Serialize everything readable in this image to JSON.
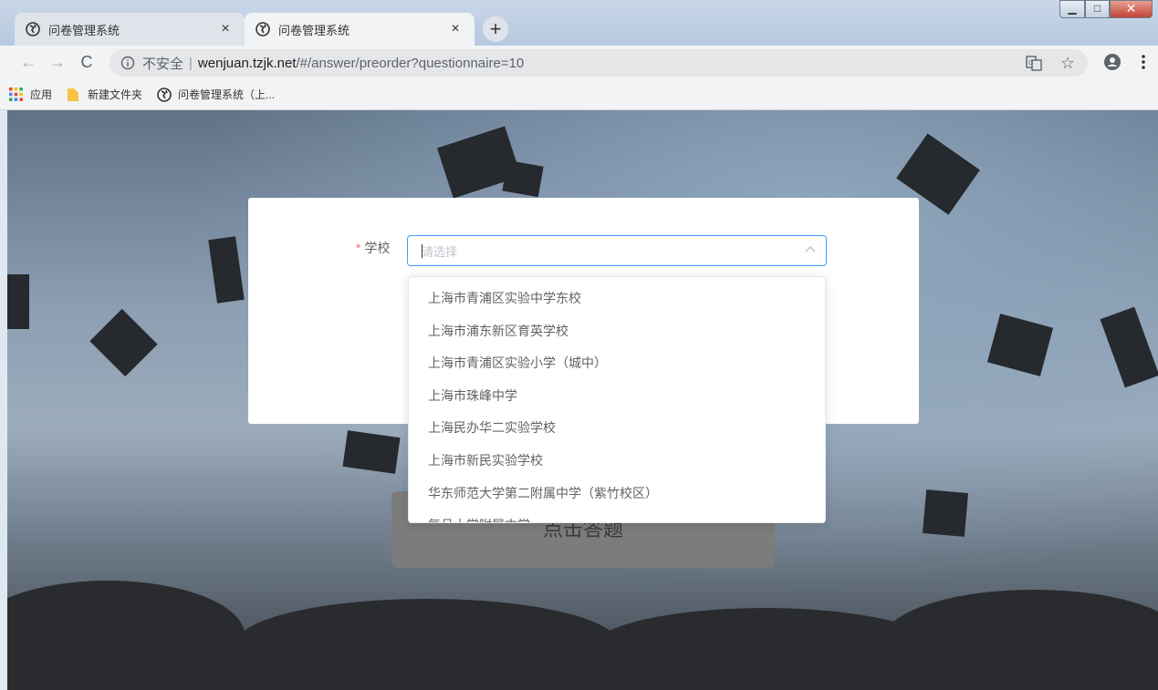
{
  "browser": {
    "tabs": [
      {
        "title": "问卷管理系统",
        "active": false
      },
      {
        "title": "问卷管理系统",
        "active": true
      }
    ],
    "new_tab_label": "+",
    "close_glyph": "×",
    "address": {
      "security_label": "不安全",
      "separator": "|",
      "host": "wenjuan.tzjk.net",
      "path": "/#/answer/preorder?questionnaire=10"
    },
    "bookmarks": [
      {
        "label": "应用",
        "icon": "apps-grid-icon"
      },
      {
        "label": "新建文件夹",
        "icon": "folder-icon"
      },
      {
        "label": "问卷管理系统（上...",
        "icon": "globe-icon"
      }
    ]
  },
  "form": {
    "field_label": "学校",
    "required_mark": "*",
    "select_placeholder": "请选择",
    "submit_label": "点击答题"
  },
  "dropdown": {
    "options": [
      "上海市青浦区实验中学东校",
      "上海市浦东新区育英学校",
      "上海市青浦区实验小学（城中）",
      "上海市珠峰中学",
      "上海民办华二实验学校",
      "上海市新民实验学校",
      "华东师范大学第二附属中学（紫竹校区）",
      "复旦大学附属中学"
    ]
  },
  "colors": {
    "accent": "#409eff",
    "required": "#f56c6c",
    "window_close": "#c24333"
  }
}
